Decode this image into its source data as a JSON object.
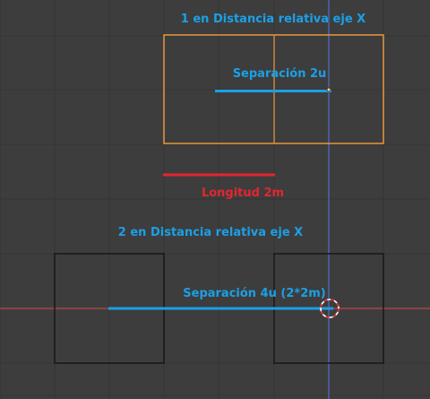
{
  "labels": {
    "top_title": "1 en Distancia relativa eje X",
    "top_separation": "Separación 2u",
    "length": "Longitud 2m",
    "bottom_title": "2 en Distancia relativa eje X",
    "bottom_separation": "Separación 4u (2*2m)"
  },
  "colors": {
    "background": "#3d3d3d",
    "grid": "#353535",
    "x_axis": "#b8474d",
    "y_axis": "#4f70c8",
    "selected_object": "#e8983c",
    "object_outline": "#161616",
    "measure_blue": "#1ba0e6",
    "measure_red": "#e3262f"
  },
  "icons": {
    "cursor": "3d-cursor-icon"
  }
}
